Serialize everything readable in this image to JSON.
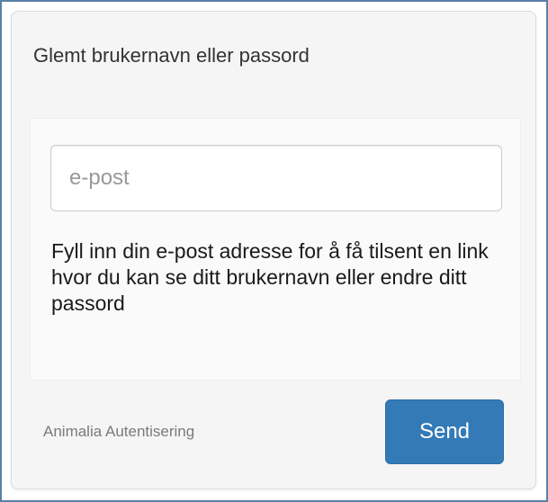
{
  "panel": {
    "title": "Glemt brukernavn eller passord"
  },
  "form": {
    "email_placeholder": "e-post",
    "email_value": "",
    "help_text": "Fyll inn din e-post adresse for å få tilsent en link hvor du kan se ditt brukernavn eller endre ditt passord"
  },
  "footer": {
    "label": "Animalia Autentisering",
    "send_label": "Send"
  },
  "colors": {
    "primary_button": "#337ab7",
    "frame_border": "#5b7fa6",
    "panel_background": "#f5f5f5"
  }
}
